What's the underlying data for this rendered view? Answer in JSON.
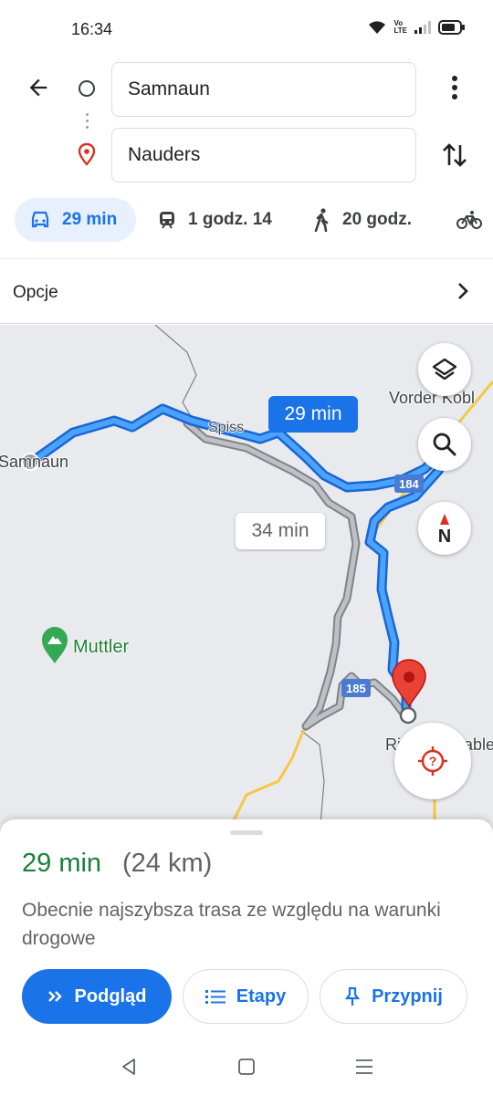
{
  "status": {
    "time": "16:34",
    "network_tag_top": "Vo",
    "network_tag_bottom": "LTE"
  },
  "search": {
    "origin": "Samnaun",
    "destination": "Nauders"
  },
  "modes": [
    {
      "icon": "car-icon",
      "label": "29 min",
      "selected": true
    },
    {
      "icon": "train-icon",
      "label": "1 godz. 14"
    },
    {
      "icon": "walk-icon",
      "label": "20 godz."
    },
    {
      "icon": "bike-icon",
      "label": ""
    }
  ],
  "options": {
    "label": "Opcje"
  },
  "map": {
    "labels": {
      "samnaun": "Samnaun",
      "spiss": "Spiss",
      "vorder_kobl": "Vorder Kobl",
      "muttler": "Muttler",
      "ri": "Ri",
      "able": "able"
    },
    "route_main_time": "29 min",
    "route_alt_time": "34 min",
    "road_184": "184",
    "road_185": "185",
    "compass_letter": "N",
    "colors": {
      "route_main": "#4285f4",
      "route_alt": "#9aa0a6",
      "pin": "#ea4335",
      "highway": "#f6c744"
    }
  },
  "sheet": {
    "eta": "29 min",
    "distance": "(24 km)",
    "description": "Obecnie najszybsza trasa ze względu na warunki drogowe",
    "buttons": {
      "preview": "Podgląd",
      "steps": "Etapy",
      "pin": "Przypnij"
    }
  },
  "nav": {
    "back": "back-icon",
    "home": "home-icon",
    "recents": "menu-icon"
  }
}
